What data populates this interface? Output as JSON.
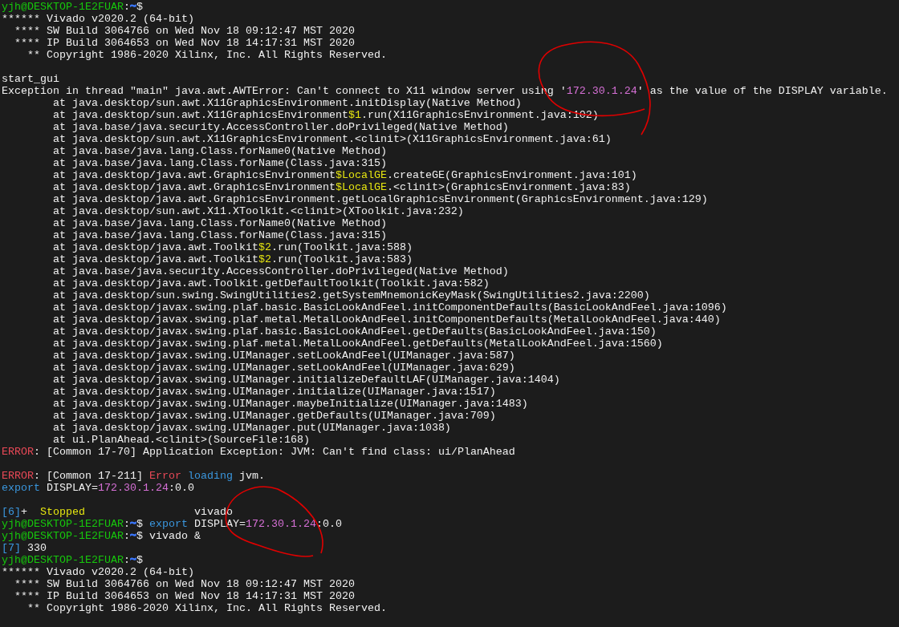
{
  "terminal": {
    "lines": [
      {
        "kind": "text",
        "segments": [
          {
            "text": "yjh@DESKTOP-1E2FUAR",
            "color": "#16c60c"
          },
          {
            "text": ":"
          },
          {
            "text": "~",
            "color": "#3b78ff"
          },
          {
            "text": "$"
          }
        ]
      },
      {
        "kind": "text",
        "segments": [
          {
            "text": "****** Vivado v2020.2 (64-bit)"
          }
        ]
      },
      {
        "kind": "text",
        "segments": [
          {
            "text": "  **** SW Build 3064766 on Wed Nov 18 09:12:47 MST 2020"
          }
        ]
      },
      {
        "kind": "text",
        "segments": [
          {
            "text": "  **** IP Build 3064653 on Wed Nov 18 14:17:31 MST 2020"
          }
        ]
      },
      {
        "kind": "text",
        "segments": [
          {
            "text": "    ** Copyright 1986-2020 Xilinx, Inc. All Rights Reserved."
          }
        ]
      },
      {
        "kind": "blank"
      },
      {
        "kind": "text",
        "segments": [
          {
            "text": "start_gui"
          }
        ]
      },
      {
        "kind": "text",
        "segments": [
          {
            "text": "Exception in thread \"main\" java.awt.AWTError: Can't connect to X11 window server using '"
          },
          {
            "text": "172.30.1.24",
            "color": "#d670d6"
          },
          {
            "text": "' as the value of the DISPLAY variable."
          }
        ]
      },
      {
        "kind": "text",
        "segments": [
          {
            "text": "        at java.desktop/sun.awt.X11GraphicsEnvironment.initDisplay(Native Method)"
          }
        ]
      },
      {
        "kind": "text",
        "segments": [
          {
            "text": "        at java.desktop/sun.awt.X11GraphicsEnvironment"
          },
          {
            "text": "$1",
            "color": "#e5e510"
          },
          {
            "text": ".run(X11GraphicsEnvironment.java:102)"
          }
        ]
      },
      {
        "kind": "text",
        "segments": [
          {
            "text": "        at java.base/java.security.AccessController.doPrivileged(Native Method)"
          }
        ]
      },
      {
        "kind": "text",
        "segments": [
          {
            "text": "        at java.desktop/sun.awt.X11GraphicsEnvironment.<clinit>(X11GraphicsEnvironment.java:61)"
          }
        ]
      },
      {
        "kind": "text",
        "segments": [
          {
            "text": "        at java.base/java.lang.Class.forName0(Native Method)"
          }
        ]
      },
      {
        "kind": "text",
        "segments": [
          {
            "text": "        at java.base/java.lang.Class.forName(Class.java:315)"
          }
        ]
      },
      {
        "kind": "text",
        "segments": [
          {
            "text": "        at java.desktop/java.awt.GraphicsEnvironment"
          },
          {
            "text": "$LocalGE",
            "color": "#e5e510"
          },
          {
            "text": ".createGE(GraphicsEnvironment.java:101)"
          }
        ]
      },
      {
        "kind": "text",
        "segments": [
          {
            "text": "        at java.desktop/java.awt.GraphicsEnvironment"
          },
          {
            "text": "$LocalGE",
            "color": "#e5e510"
          },
          {
            "text": ".<clinit>(GraphicsEnvironment.java:83)"
          }
        ]
      },
      {
        "kind": "text",
        "segments": [
          {
            "text": "        at java.desktop/java.awt.GraphicsEnvironment.getLocalGraphicsEnvironment(GraphicsEnvironment.java:129)"
          }
        ]
      },
      {
        "kind": "text",
        "segments": [
          {
            "text": "        at java.desktop/sun.awt.X11.XToolkit.<clinit>(XToolkit.java:232)"
          }
        ]
      },
      {
        "kind": "text",
        "segments": [
          {
            "text": "        at java.base/java.lang.Class.forName0(Native Method)"
          }
        ]
      },
      {
        "kind": "text",
        "segments": [
          {
            "text": "        at java.base/java.lang.Class.forName(Class.java:315)"
          }
        ]
      },
      {
        "kind": "text",
        "segments": [
          {
            "text": "        at java.desktop/java.awt.Toolkit"
          },
          {
            "text": "$2",
            "color": "#e5e510"
          },
          {
            "text": ".run(Toolkit.java:588)"
          }
        ]
      },
      {
        "kind": "text",
        "segments": [
          {
            "text": "        at java.desktop/java.awt.Toolkit"
          },
          {
            "text": "$2",
            "color": "#e5e510"
          },
          {
            "text": ".run(Toolkit.java:583)"
          }
        ]
      },
      {
        "kind": "text",
        "segments": [
          {
            "text": "        at java.base/java.security.AccessController.doPrivileged(Native Method)"
          }
        ]
      },
      {
        "kind": "text",
        "segments": [
          {
            "text": "        at java.desktop/java.awt.Toolkit.getDefaultToolkit(Toolkit.java:582)"
          }
        ]
      },
      {
        "kind": "text",
        "segments": [
          {
            "text": "        at java.desktop/sun.swing.SwingUtilities2.getSystemMnemonicKeyMask(SwingUtilities2.java:2200)"
          }
        ]
      },
      {
        "kind": "text",
        "segments": [
          {
            "text": "        at java.desktop/javax.swing.plaf.basic.BasicLookAndFeel.initComponentDefaults(BasicLookAndFeel.java:1096)"
          }
        ]
      },
      {
        "kind": "text",
        "segments": [
          {
            "text": "        at java.desktop/javax.swing.plaf.metal.MetalLookAndFeel.initComponentDefaults(MetalLookAndFeel.java:440)"
          }
        ]
      },
      {
        "kind": "text",
        "segments": [
          {
            "text": "        at java.desktop/javax.swing.plaf.basic.BasicLookAndFeel.getDefaults(BasicLookAndFeel.java:150)"
          }
        ]
      },
      {
        "kind": "text",
        "segments": [
          {
            "text": "        at java.desktop/javax.swing.plaf.metal.MetalLookAndFeel.getDefaults(MetalLookAndFeel.java:1560)"
          }
        ]
      },
      {
        "kind": "text",
        "segments": [
          {
            "text": "        at java.desktop/javax.swing.UIManager.setLookAndFeel(UIManager.java:587)"
          }
        ]
      },
      {
        "kind": "text",
        "segments": [
          {
            "text": "        at java.desktop/javax.swing.UIManager.setLookAndFeel(UIManager.java:629)"
          }
        ]
      },
      {
        "kind": "text",
        "segments": [
          {
            "text": "        at java.desktop/javax.swing.UIManager.initializeDefaultLAF(UIManager.java:1404)"
          }
        ]
      },
      {
        "kind": "text",
        "segments": [
          {
            "text": "        at java.desktop/javax.swing.UIManager.initialize(UIManager.java:1517)"
          }
        ]
      },
      {
        "kind": "text",
        "segments": [
          {
            "text": "        at java.desktop/javax.swing.UIManager.maybeInitialize(UIManager.java:1483)"
          }
        ]
      },
      {
        "kind": "text",
        "segments": [
          {
            "text": "        at java.desktop/javax.swing.UIManager.getDefaults(UIManager.java:709)"
          }
        ]
      },
      {
        "kind": "text",
        "segments": [
          {
            "text": "        at java.desktop/javax.swing.UIManager.put(UIManager.java:1038)"
          }
        ]
      },
      {
        "kind": "text",
        "segments": [
          {
            "text": "        at ui.PlanAhead.<clinit>(SourceFile:168)"
          }
        ]
      },
      {
        "kind": "text",
        "segments": [
          {
            "text": "ERROR",
            "color": "#e74856"
          },
          {
            "text": ": [Common 17-70] Application Exception: JVM: Can't find class: ui/PlanAhead"
          }
        ]
      },
      {
        "kind": "blank"
      },
      {
        "kind": "text",
        "segments": [
          {
            "text": "ERROR",
            "color": "#e74856"
          },
          {
            "text": ": [Common 17-211] "
          },
          {
            "text": "Error",
            "color": "#e74856"
          },
          {
            "text": " loading",
            "color": "#3a96dd"
          },
          {
            "text": " jvm."
          }
        ]
      },
      {
        "kind": "text",
        "segments": [
          {
            "text": "export",
            "color": "#3a96dd"
          },
          {
            "text": " DISPLAY="
          },
          {
            "text": "172.30.1.24",
            "color": "#d670d6"
          },
          {
            "text": ":0.0"
          }
        ]
      },
      {
        "kind": "blank"
      },
      {
        "kind": "text",
        "segments": [
          {
            "text": "[6]",
            "color": "#3a96dd"
          },
          {
            "text": "+  "
          },
          {
            "text": "Stopped",
            "color": "#e5e510"
          },
          {
            "text": "                 vivado"
          }
        ]
      },
      {
        "kind": "text",
        "segments": [
          {
            "text": "yjh@DESKTOP-1E2FUAR",
            "color": "#16c60c"
          },
          {
            "text": ":"
          },
          {
            "text": "~",
            "color": "#3b78ff"
          },
          {
            "text": "$ "
          },
          {
            "text": "export",
            "color": "#3a96dd"
          },
          {
            "text": " DISPLAY="
          },
          {
            "text": "172.30.1.24",
            "color": "#d670d6"
          },
          {
            "text": ":0.0"
          }
        ]
      },
      {
        "kind": "text",
        "segments": [
          {
            "text": "yjh@DESKTOP-1E2FUAR",
            "color": "#16c60c"
          },
          {
            "text": ":"
          },
          {
            "text": "~",
            "color": "#3b78ff"
          },
          {
            "text": "$ vivado &"
          }
        ]
      },
      {
        "kind": "text",
        "segments": [
          {
            "text": "[7]",
            "color": "#3a96dd"
          },
          {
            "text": " 330"
          }
        ]
      },
      {
        "kind": "text",
        "segments": [
          {
            "text": "yjh@DESKTOP-1E2FUAR",
            "color": "#16c60c"
          },
          {
            "text": ":"
          },
          {
            "text": "~",
            "color": "#3b78ff"
          },
          {
            "text": "$"
          }
        ]
      },
      {
        "kind": "text",
        "segments": [
          {
            "text": "****** Vivado v2020.2 (64-bit)"
          }
        ]
      },
      {
        "kind": "text",
        "segments": [
          {
            "text": "  **** SW Build 3064766 on Wed Nov 18 09:12:47 MST 2020"
          }
        ]
      },
      {
        "kind": "text",
        "segments": [
          {
            "text": "  **** IP Build 3064653 on Wed Nov 18 14:17:31 MST 2020"
          }
        ]
      },
      {
        "kind": "text",
        "segments": [
          {
            "text": "    ** Copyright 1986-2020 Xilinx, Inc. All Rights Reserved."
          }
        ]
      }
    ]
  }
}
